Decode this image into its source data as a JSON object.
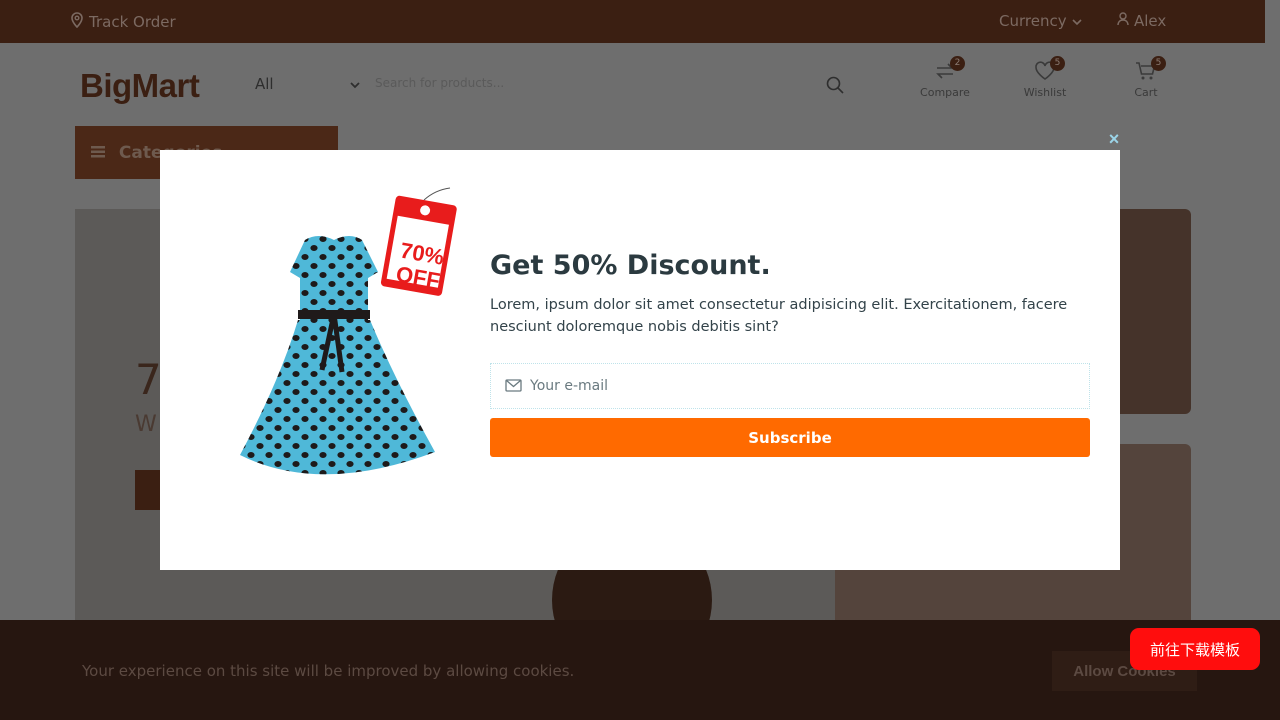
{
  "topbar": {
    "track_order": "Track Order",
    "currency": "Currency",
    "user": "Alex"
  },
  "header": {
    "logo": "BigMart",
    "category_select": "All",
    "search_placeholder": "Search for products...",
    "compare": {
      "label": "Compare",
      "count": "2"
    },
    "wishlist": {
      "label": "Wishlist",
      "count": "5"
    },
    "cart": {
      "label": "Cart",
      "count": "5"
    }
  },
  "nav": {
    "categories_button": "Categories"
  },
  "hero": {
    "headline": "7",
    "subline": "W"
  },
  "cookie": {
    "text": "Your experience on this site will be improved by allowing cookies.",
    "button": "Allow Cookies"
  },
  "download_button": "前往下载模板",
  "popup": {
    "close": "×",
    "tag_line1": "70%",
    "tag_line2": "OFF",
    "title": "Get 50% Discount.",
    "description": "Lorem, ipsum dolor sit amet consectetur adipisicing elit. Exercitationem, facere nesciunt doloremque nobis debitis sint?",
    "email_placeholder": "Your e-mail",
    "subscribe": "Subscribe"
  },
  "colors": {
    "accent": "#ff6a00",
    "overlay_dark": "#3b1f12",
    "download_red": "#ff0d0d"
  }
}
